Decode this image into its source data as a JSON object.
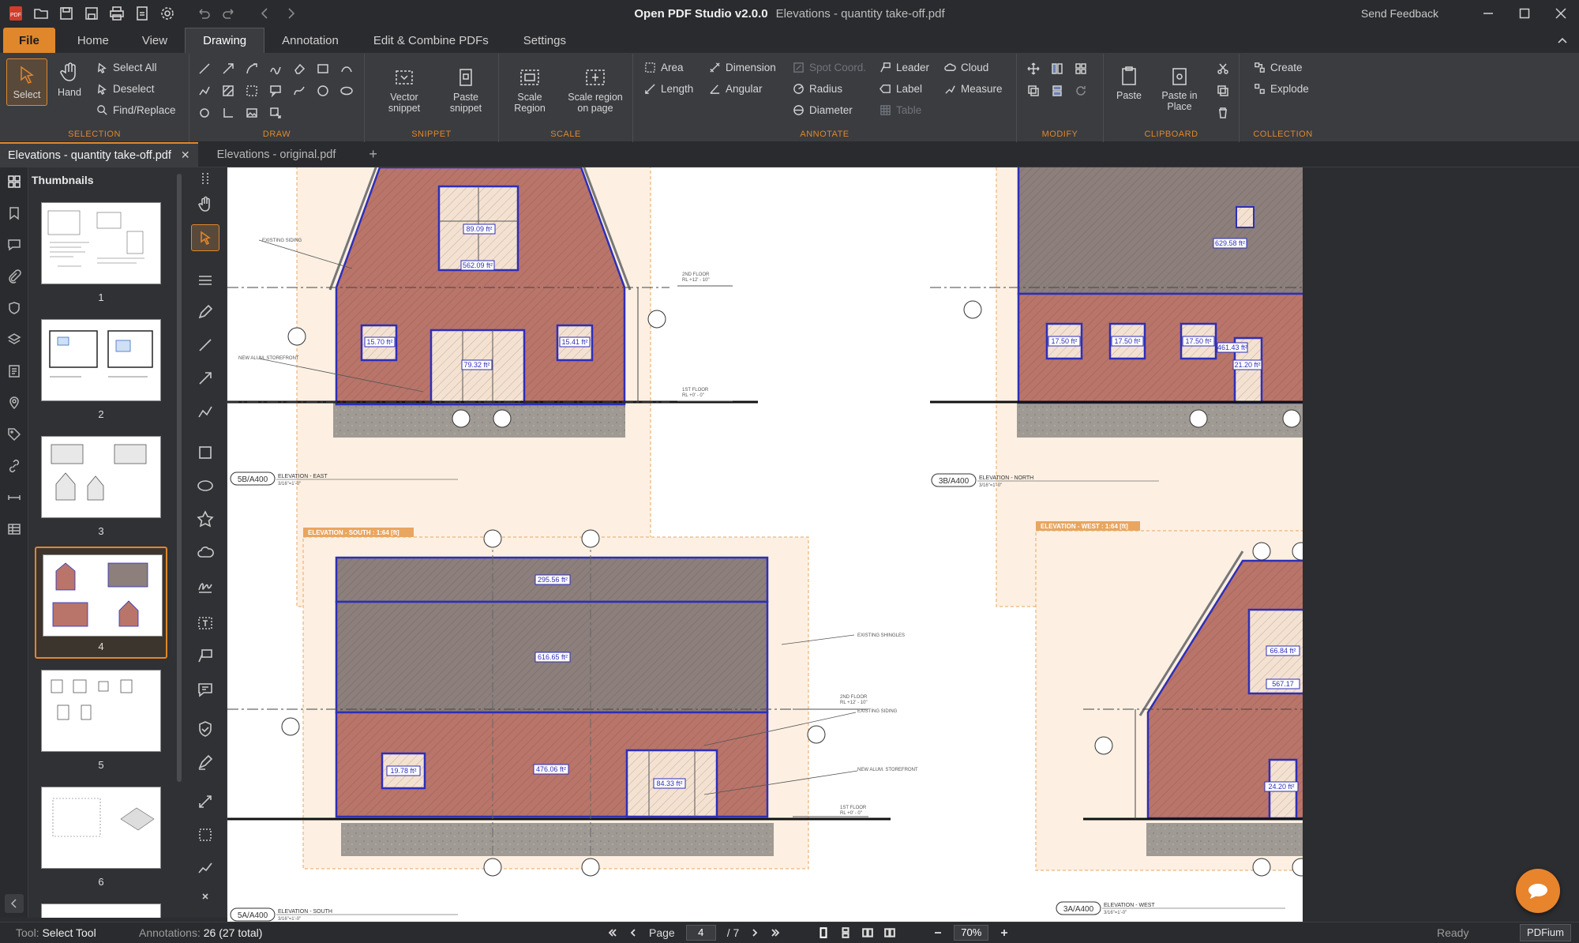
{
  "window": {
    "app_name": "Open PDF Studio v2.0.0",
    "doc_title": "Elevations - quantity take-off.pdf",
    "send_feedback": "Send Feedback"
  },
  "menu": {
    "file": "File",
    "tabs": [
      "Home",
      "View",
      "Drawing",
      "Annotation",
      "Edit & Combine PDFs",
      "Settings"
    ],
    "active_tab": "Drawing"
  },
  "ribbon": {
    "selection": {
      "label": "SELECTION",
      "select": "Select",
      "hand": "Hand",
      "select_all": "Select All",
      "deselect": "Deselect",
      "find_replace": "Find/Replace"
    },
    "draw": {
      "label": "DRAW"
    },
    "snippet": {
      "label": "SNIPPET",
      "vector_snippet": "Vector snippet",
      "paste_snippet": "Paste snippet"
    },
    "scale": {
      "label": "SCALE",
      "scale_region": "Scale Region",
      "scale_region_on_page": "Scale region on page"
    },
    "annotate": {
      "label": "ANNOTATE",
      "area": "Area",
      "length": "Length",
      "dimension": "Dimension",
      "angular": "Angular",
      "spot_coord": "Spot Coord.",
      "radius": "Radius",
      "diameter": "Diameter",
      "leader": "Leader",
      "label_btn": "Label",
      "table": "Table",
      "cloud": "Cloud",
      "measure": "Measure"
    },
    "modify": {
      "label": "MODIFY"
    },
    "clipboard": {
      "label": "CLIPBOARD",
      "paste": "Paste",
      "paste_in_place": "Paste in Place"
    },
    "collection": {
      "label": "COLLECTION",
      "create": "Create",
      "explode": "Explode"
    }
  },
  "doc_tabs": [
    {
      "name": "Elevations - quantity take-off.pdf",
      "active": true
    },
    {
      "name": "Elevations - original.pdf",
      "active": false
    }
  ],
  "thumbnails": {
    "header": "Thumbnails",
    "pages": [
      "1",
      "2",
      "3",
      "4",
      "5",
      "6"
    ],
    "active_page": "4"
  },
  "drawing": {
    "east": {
      "tag": "5B/A400",
      "title": "ELEVATION - EAST",
      "scale": "3/16\"=1'-0\"",
      "areas": [
        "89.09 ft²",
        "562.09 ft²",
        "15.70 ft²",
        "79.32 ft²",
        "15.41 ft²"
      ],
      "notes": [
        "EXISTING SIDING",
        "NEW ALUM. STOREFRONT",
        "2ND FLOOR",
        "RL +12' - 10\"",
        "1ST FLOOR",
        "RL +0' - 0\""
      ]
    },
    "north": {
      "tag": "3B/A400",
      "title": "ELEVATION - NORTH",
      "scale": "3/16\"=1'-0\"",
      "areas": [
        "629.58 ft²",
        "17.50 ft²",
        "17.50 ft²",
        "17.50 ft²",
        "461.43 ft²",
        "21.20 ft²"
      ]
    },
    "south": {
      "tag": "5A/A400",
      "title": "ELEVATION - SOUTH",
      "scale": "3/16\"=1'-0\"",
      "region_label": "ELEVATION - SOUTH : 1:64 [ft]",
      "areas": [
        "295.56 ft²",
        "616.65 ft²",
        "19.78 ft²",
        "476.06 ft²",
        "84.33 ft²"
      ],
      "notes": [
        "EXISTING SHINGLES",
        "EXISTING SIDING",
        "NEW ALUM. STOREFRONT",
        "2ND FLOOR",
        "RL +12' - 10\"",
        "1ST FLOOR",
        "RL +0' - 0\""
      ]
    },
    "west": {
      "tag": "3A/A400",
      "title": "ELEVATION - WEST",
      "scale": "3/16\"=1'-0\"",
      "region_label": "ELEVATION - WEST : 1:64 [ft]",
      "areas": [
        "66.84 ft²",
        "567.17",
        "24.20 ft²"
      ]
    }
  },
  "status": {
    "tool_label": "Tool:",
    "tool_value": "Select Tool",
    "annotations_label": "Annotations:",
    "annotations_value": "26 (27 total)",
    "page_label": "Page",
    "page_current": "4",
    "page_total": "/ 7",
    "zoom": "70%",
    "ready": "Ready",
    "engine": "PDFium"
  },
  "colors": {
    "accent": "#e0872b",
    "area_stroke": "#2d2fb8",
    "area_fill": "#b9756a",
    "roof_fill": "#8c7f7c",
    "region_fill": "#fdf0e2"
  }
}
